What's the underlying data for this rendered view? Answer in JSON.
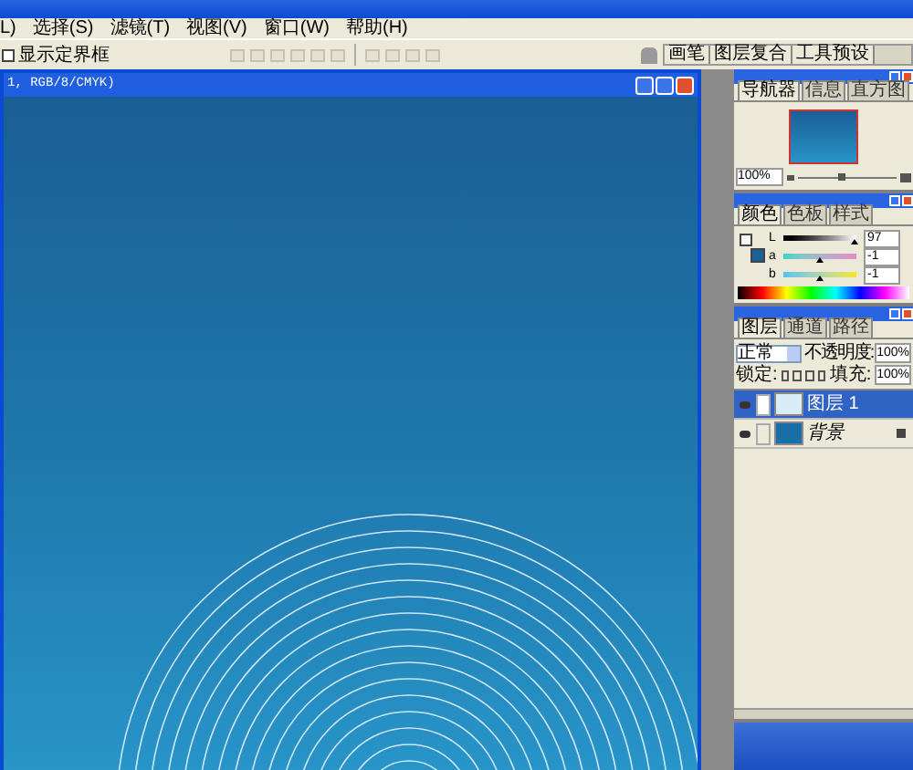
{
  "menu_bar": [
    "L)",
    "选择(S)",
    "滤镜(T)",
    "视图(V)",
    "窗口(W)",
    "帮助(H)"
  ],
  "options_bar": {
    "checkbox": {
      "label": "显示定界框",
      "checked": false
    },
    "palette_tabs": [
      "画笔",
      "图层复合",
      "工具预设"
    ]
  },
  "document": {
    "title": "1, RGB/8/CMYK)"
  },
  "navigator": {
    "tabs": [
      {
        "label": "导航器",
        "selected": true
      },
      {
        "label": "信息",
        "selected": false
      },
      {
        "label": "直方图",
        "selected": false
      }
    ],
    "zoom": "100%",
    "level": 0.45
  },
  "color": {
    "tabs": [
      {
        "label": "颜色",
        "selected": true
      },
      {
        "label": "色板",
        "selected": false
      },
      {
        "label": "样式",
        "selected": false
      }
    ],
    "sliders": [
      {
        "label": "L",
        "value": "97",
        "level": 0.97,
        "kind": "gray"
      },
      {
        "label": "a",
        "value": "-1",
        "level": 0.5,
        "kind": "cyan-pink"
      },
      {
        "label": "b",
        "value": "-1",
        "level": 0.5,
        "kind": "blue-yellow"
      }
    ]
  },
  "layers": {
    "tabs": [
      {
        "label": "图层",
        "selected": true
      },
      {
        "label": "通道",
        "selected": false
      },
      {
        "label": "路径",
        "selected": false
      }
    ],
    "blend_mode": "正常",
    "opacity_label": "不透明度:",
    "opacity": "100%",
    "lock_label": "锁定:",
    "fill_label": "填充:",
    "fill": "100%",
    "items": [
      {
        "name": "图层 1",
        "selected": true,
        "locked": false
      },
      {
        "name": "背景",
        "selected": false,
        "locked": true
      }
    ]
  }
}
